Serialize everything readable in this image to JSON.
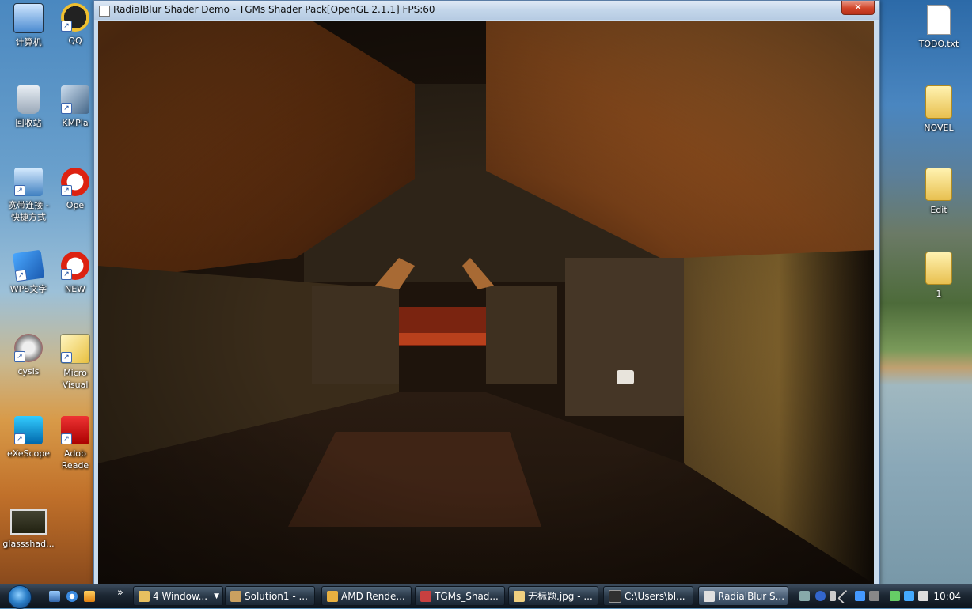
{
  "desktop": {
    "icons_left": [
      {
        "label": "计算机"
      },
      {
        "label": "QQ"
      },
      {
        "label": "回收站"
      },
      {
        "label": "KMPla"
      },
      {
        "label": "宽带连接 -"
      },
      {
        "label": "快捷方式"
      },
      {
        "label": "Ope"
      },
      {
        "label": "WPS文字"
      },
      {
        "label": "NEW"
      },
      {
        "label": "cysis"
      },
      {
        "label": "Micro"
      },
      {
        "label": "Visual"
      },
      {
        "label": "eXeScope"
      },
      {
        "label": "Adob"
      },
      {
        "label": "Reade"
      },
      {
        "label": "glassshad..."
      }
    ],
    "icons_right": [
      {
        "label": "TODO.txt"
      },
      {
        "label": "NOVEL"
      },
      {
        "label": "Edit"
      },
      {
        "label": "1"
      }
    ]
  },
  "window": {
    "title": "RadialBlur Shader Demo - TGMs Shader Pack[OpenGL 2.1.1] FPS:60",
    "close_label": "✕"
  },
  "taskbar": {
    "overflow_label": "»",
    "tasks": [
      {
        "label": "4 Window...",
        "icon_color": "#e8c060",
        "has_arrow": true,
        "arrow": "▼"
      },
      {
        "label": "Solution1 - ...",
        "icon_color": "#caa060"
      },
      {
        "label": "AMD Rende...",
        "icon_color": "#e8b040"
      },
      {
        "label": "TGMs_Shad...",
        "icon_color": "#c84040"
      },
      {
        "label": "无标题.jpg - ...",
        "icon_color": "#f0d080"
      },
      {
        "label": "C:\\Users\\bl...",
        "icon_color": "#303030"
      },
      {
        "label": "RadialBlur S...",
        "icon_color": "#e0e0e0",
        "active": true
      }
    ],
    "clock": "10:04"
  },
  "colors": {
    "accent": "#2c7fc8",
    "close_red": "#d2452a"
  }
}
